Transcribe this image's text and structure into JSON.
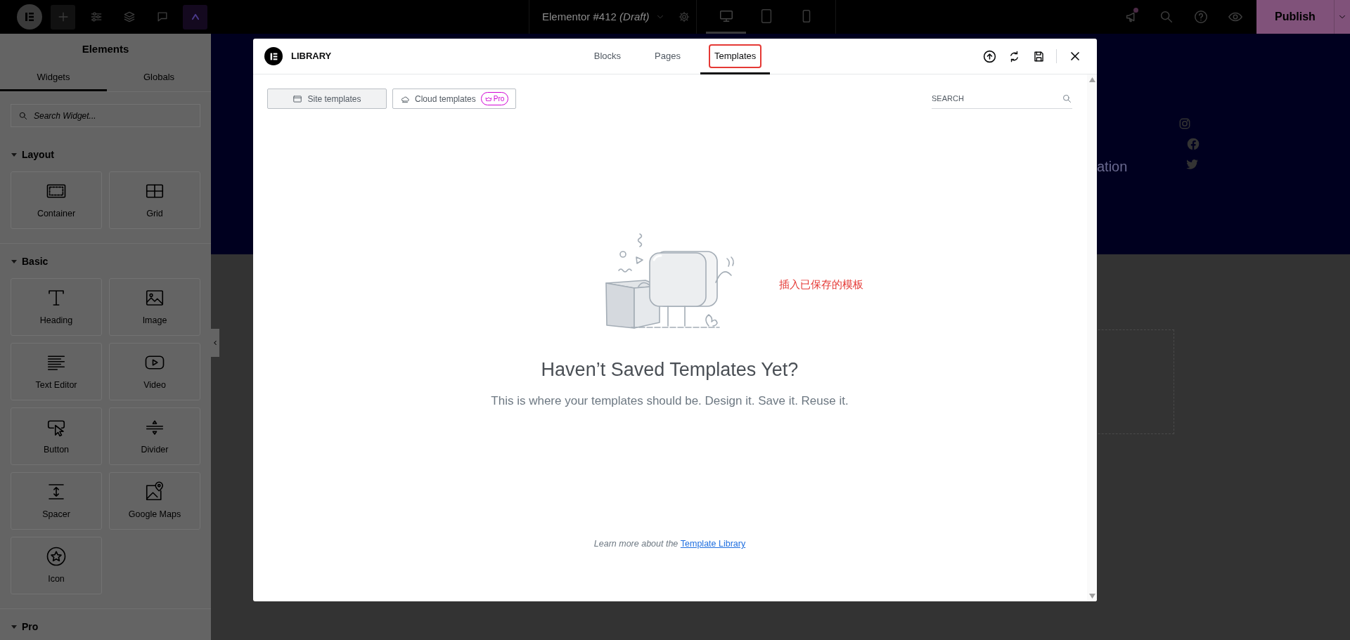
{
  "top_bar": {
    "document_title": "Elementor #412",
    "document_status": "(Draft)",
    "has_notification": true,
    "publish_label": "Publish",
    "devices": [
      {
        "kind": "desktop",
        "selected": true
      },
      {
        "kind": "tablet",
        "selected": false
      },
      {
        "kind": "mobile",
        "selected": false
      }
    ]
  },
  "panel": {
    "title": "Elements",
    "tabs": [
      {
        "label": "Widgets",
        "selected": true
      },
      {
        "label": "Globals",
        "selected": false
      }
    ],
    "search": {
      "placeholder": "Search Widget..."
    },
    "sections": [
      {
        "title": "Layout",
        "expanded": true,
        "widgets": [
          {
            "label": "Container",
            "kind": "container"
          },
          {
            "label": "Grid",
            "kind": "grid"
          }
        ]
      },
      {
        "title": "Basic",
        "expanded": true,
        "widgets": [
          {
            "label": "Heading",
            "kind": "heading"
          },
          {
            "label": "Image",
            "kind": "image"
          },
          {
            "label": "Text Editor",
            "kind": "text-editor"
          },
          {
            "label": "Video",
            "kind": "video"
          },
          {
            "label": "Button",
            "kind": "button"
          },
          {
            "label": "Divider",
            "kind": "divider"
          },
          {
            "label": "Spacer",
            "kind": "spacer"
          },
          {
            "label": "Google Maps",
            "kind": "google-maps"
          },
          {
            "label": "Icon",
            "kind": "icon"
          }
        ]
      },
      {
        "title": "Pro",
        "expanded": true
      }
    ]
  },
  "canvas": {
    "hero_text": "ation"
  },
  "library": {
    "title": "LIBRARY",
    "tabs": [
      {
        "label": "Blocks",
        "selected": false,
        "annotated": false
      },
      {
        "label": "Pages",
        "selected": false,
        "annotated": false
      },
      {
        "label": "Templates",
        "selected": true,
        "annotated": true
      }
    ],
    "filters": [
      {
        "label": "Site templates",
        "selected": true
      },
      {
        "label": "Cloud templates",
        "selected": false,
        "badge": "Pro"
      }
    ],
    "search": {
      "placeholder": "SEARCH"
    },
    "annotation": "插入已保存的模板",
    "empty_heading": "Haven’t Saved Templates Yet?",
    "empty_text": "This is where your templates should be. Design it. Save it. Reuse it.",
    "footer_text": "Learn more about the ",
    "footer_link": "Template Library"
  }
}
